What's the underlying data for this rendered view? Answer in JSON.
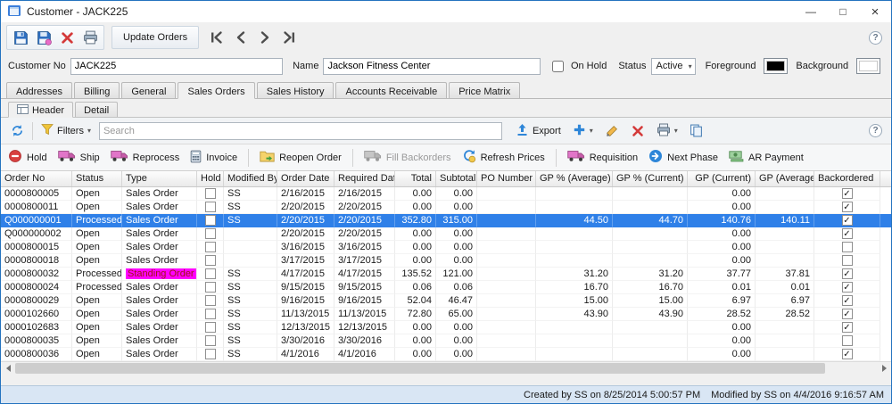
{
  "window": {
    "title": "Customer - JACK225"
  },
  "icons": {
    "minimize": "—",
    "maximize": "□",
    "close": "×",
    "caret": "▾",
    "help": "?",
    "check": "✓"
  },
  "colors": {
    "selection": "#2f80e8",
    "standing_bg": "#ff00ff",
    "standing_fg": "#a01414"
  },
  "toolbar": {
    "update_orders_label": "Update Orders"
  },
  "customer": {
    "customer_no_label": "Customer No",
    "customer_no_value": "JACK225",
    "name_label": "Name",
    "name_value": "Jackson Fitness Center",
    "on_hold_label": "On Hold",
    "status_label": "Status",
    "status_value": "Active",
    "foreground_label": "Foreground",
    "background_label": "Background",
    "foreground_color": "#000000",
    "background_color": "#ffffff"
  },
  "tabs": [
    {
      "label": "Addresses"
    },
    {
      "label": "Billing"
    },
    {
      "label": "General"
    },
    {
      "label": "Sales Orders",
      "active": true
    },
    {
      "label": "Sales History"
    },
    {
      "label": "Accounts Receivable"
    },
    {
      "label": "Price Matrix"
    }
  ],
  "subtabs": [
    {
      "label": "Header",
      "active": true
    },
    {
      "label": "Detail"
    }
  ],
  "grid_toolbar": {
    "filters_label": "Filters",
    "search_placeholder": "Search",
    "export_label": "Export"
  },
  "actions": [
    {
      "label": "Hold"
    },
    {
      "label": "Ship"
    },
    {
      "label": "Reprocess"
    },
    {
      "label": "Invoice"
    },
    {
      "label": "Reopen Order"
    },
    {
      "label": "Fill Backorders",
      "disabled": true
    },
    {
      "label": "Refresh Prices"
    },
    {
      "label": "Requisition"
    },
    {
      "label": "Next Phase"
    },
    {
      "label": "AR Payment"
    }
  ],
  "table": {
    "columns": [
      "Order No",
      "Status",
      "Type",
      "Hold",
      "Modified By",
      "Order Date",
      "Required Date",
      "Total",
      "Subtotal",
      "PO Number",
      "GP % (Average)",
      "GP % (Current)",
      "GP (Current)",
      "GP (Average)",
      "Backordered"
    ],
    "rows": [
      {
        "order_no": "0000800005",
        "status": "Open",
        "type": "Sales Order",
        "hold": false,
        "modified_by": "SS",
        "order_date": "2/16/2015",
        "required_date": "2/16/2015",
        "total": "0.00",
        "subtotal": "0.00",
        "po_number": "",
        "gp_pct_avg": "",
        "gp_pct_cur": "",
        "gp_cur": "0.00",
        "gp_avg": "",
        "backordered": true
      },
      {
        "order_no": "0000800011",
        "status": "Open",
        "type": "Sales Order",
        "hold": false,
        "modified_by": "SS",
        "order_date": "2/20/2015",
        "required_date": "2/20/2015",
        "total": "0.00",
        "subtotal": "0.00",
        "po_number": "",
        "gp_pct_avg": "",
        "gp_pct_cur": "",
        "gp_cur": "0.00",
        "gp_avg": "",
        "backordered": true
      },
      {
        "order_no": "Q000000001",
        "status": "Processed",
        "type": "Sales Order",
        "hold": false,
        "modified_by": "SS",
        "order_date": "2/20/2015",
        "required_date": "2/20/2015",
        "total": "352.80",
        "subtotal": "315.00",
        "po_number": "",
        "gp_pct_avg": "44.50",
        "gp_pct_cur": "44.70",
        "gp_cur": "140.76",
        "gp_avg": "140.11",
        "backordered": true,
        "selected": true
      },
      {
        "order_no": "Q000000002",
        "status": "Open",
        "type": "Sales Order",
        "hold": false,
        "modified_by": "",
        "order_date": "2/20/2015",
        "required_date": "2/20/2015",
        "total": "0.00",
        "subtotal": "0.00",
        "po_number": "",
        "gp_pct_avg": "",
        "gp_pct_cur": "",
        "gp_cur": "0.00",
        "gp_avg": "",
        "backordered": true
      },
      {
        "order_no": "0000800015",
        "status": "Open",
        "type": "Sales Order",
        "hold": false,
        "modified_by": "",
        "order_date": "3/16/2015",
        "required_date": "3/16/2015",
        "total": "0.00",
        "subtotal": "0.00",
        "po_number": "",
        "gp_pct_avg": "",
        "gp_pct_cur": "",
        "gp_cur": "0.00",
        "gp_avg": "",
        "backordered": false
      },
      {
        "order_no": "0000800018",
        "status": "Open",
        "type": "Sales Order",
        "hold": false,
        "modified_by": "",
        "order_date": "3/17/2015",
        "required_date": "3/17/2015",
        "total": "0.00",
        "subtotal": "0.00",
        "po_number": "",
        "gp_pct_avg": "",
        "gp_pct_cur": "",
        "gp_cur": "0.00",
        "gp_avg": "",
        "backordered": false
      },
      {
        "order_no": "0000800032",
        "status": "Processed",
        "type": "Standing Order",
        "standing": true,
        "hold": false,
        "modified_by": "SS",
        "order_date": "4/17/2015",
        "required_date": "4/17/2015",
        "total": "135.52",
        "subtotal": "121.00",
        "po_number": "",
        "gp_pct_avg": "31.20",
        "gp_pct_cur": "31.20",
        "gp_cur": "37.77",
        "gp_avg": "37.81",
        "backordered": true
      },
      {
        "order_no": "0000800024",
        "status": "Processed",
        "type": "Sales Order",
        "hold": false,
        "modified_by": "SS",
        "order_date": "9/15/2015",
        "required_date": "9/15/2015",
        "total": "0.06",
        "subtotal": "0.06",
        "po_number": "",
        "gp_pct_avg": "16.70",
        "gp_pct_cur": "16.70",
        "gp_cur": "0.01",
        "gp_avg": "0.01",
        "backordered": true
      },
      {
        "order_no": "0000800029",
        "status": "Open",
        "type": "Sales Order",
        "hold": false,
        "modified_by": "SS",
        "order_date": "9/16/2015",
        "required_date": "9/16/2015",
        "total": "52.04",
        "subtotal": "46.47",
        "po_number": "",
        "gp_pct_avg": "15.00",
        "gp_pct_cur": "15.00",
        "gp_cur": "6.97",
        "gp_avg": "6.97",
        "backordered": true
      },
      {
        "order_no": "0000102660",
        "status": "Open",
        "type": "Sales Order",
        "hold": false,
        "modified_by": "SS",
        "order_date": "11/13/2015",
        "required_date": "11/13/2015",
        "total": "72.80",
        "subtotal": "65.00",
        "po_number": "",
        "gp_pct_avg": "43.90",
        "gp_pct_cur": "43.90",
        "gp_cur": "28.52",
        "gp_avg": "28.52",
        "backordered": true
      },
      {
        "order_no": "0000102683",
        "status": "Open",
        "type": "Sales Order",
        "hold": false,
        "modified_by": "SS",
        "order_date": "12/13/2015",
        "required_date": "12/13/2015",
        "total": "0.00",
        "subtotal": "0.00",
        "po_number": "",
        "gp_pct_avg": "",
        "gp_pct_cur": "",
        "gp_cur": "0.00",
        "gp_avg": "",
        "backordered": true
      },
      {
        "order_no": "0000800035",
        "status": "Open",
        "type": "Sales Order",
        "hold": false,
        "modified_by": "SS",
        "order_date": "3/30/2016",
        "required_date": "3/30/2016",
        "total": "0.00",
        "subtotal": "0.00",
        "po_number": "",
        "gp_pct_avg": "",
        "gp_pct_cur": "",
        "gp_cur": "0.00",
        "gp_avg": "",
        "backordered": false
      },
      {
        "order_no": "0000800036",
        "status": "Open",
        "type": "Sales Order",
        "hold": false,
        "modified_by": "SS",
        "order_date": "4/1/2016",
        "required_date": "4/1/2016",
        "total": "0.00",
        "subtotal": "0.00",
        "po_number": "",
        "gp_pct_avg": "",
        "gp_pct_cur": "",
        "gp_cur": "0.00",
        "gp_avg": "",
        "backordered": true
      }
    ]
  },
  "statusbar": {
    "created": "Created by SS on 8/25/2014 5:00:57 PM",
    "modified": "Modified by SS on 4/4/2016 9:16:57 AM"
  }
}
